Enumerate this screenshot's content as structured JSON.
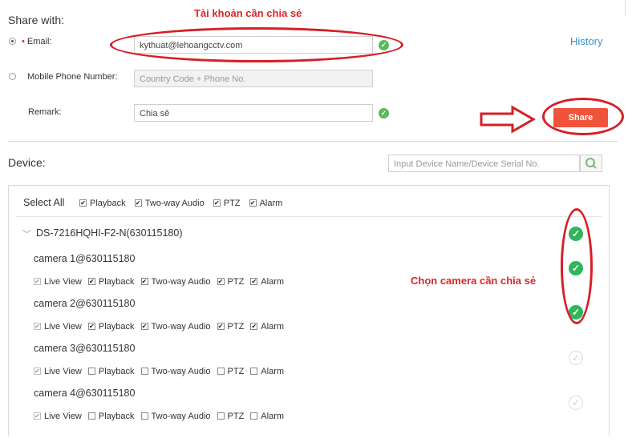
{
  "share_with": {
    "title": "Share with:",
    "annotation_account": "Tài khoản cần chia sẻ",
    "email_label": "Email:",
    "email_value": "kythuat@lehoangcctv.com",
    "phone_label": "Mobile Phone Number:",
    "phone_placeholder": "Country Code + Phone No.",
    "remark_label": "Remark:",
    "remark_value": "Chia sê",
    "history_link": "History",
    "share_button": "Share"
  },
  "device": {
    "title": "Device:",
    "search_placeholder": "Input Device Name/Device Serial No.",
    "select_all": "Select All",
    "header_perms": [
      "Playback",
      "Two-way Audio",
      "PTZ",
      "Alarm"
    ],
    "device_name": "DS-7216HQHI-F2-N(630115180)",
    "annotation_camera": "Chọn camera cần chia sẻ",
    "perm_labels": [
      "Live View",
      "Playback",
      "Two-way Audio",
      "PTZ",
      "Alarm"
    ],
    "cameras": [
      {
        "name": "camera 1@630115180",
        "checked": [
          true,
          true,
          true,
          true,
          true
        ],
        "selected": true
      },
      {
        "name": "camera 2@630115180",
        "checked": [
          true,
          true,
          true,
          true,
          true
        ],
        "selected": true
      },
      {
        "name": "camera 3@630115180",
        "checked": [
          true,
          false,
          false,
          false,
          false
        ],
        "selected": false
      },
      {
        "name": "camera 4@630115180",
        "checked": [
          true,
          false,
          false,
          false,
          false
        ],
        "selected": false
      }
    ]
  },
  "colors": {
    "accent_red": "#d9262b",
    "share_button": "#f0533a",
    "check_green": "#2fb55b",
    "link_blue": "#3a8fc8"
  },
  "icons": {
    "email_ok": "check-circle-icon",
    "search": "search-icon",
    "arrow": "right-arrow-icon",
    "collapse": "chevron-down-icon"
  }
}
